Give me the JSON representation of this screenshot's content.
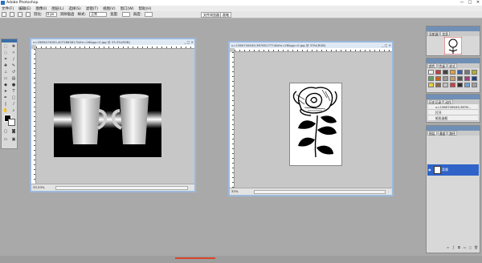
{
  "window": {
    "title": "Adobe Photoshop",
    "controls": [
      "—",
      "□",
      "✕"
    ]
  },
  "menu": [
    "文件(F)",
    "编辑(E)",
    "图像(I)",
    "图层(L)",
    "选择(S)",
    "滤镜(T)",
    "视图(V)",
    "窗口(W)",
    "帮助(H)"
  ],
  "options": {
    "feather_label": "羽化:",
    "feather_value": "0 px",
    "antialias_label": "消除锯齿",
    "style_label": "样式:",
    "style_value": "正常",
    "width_label": "宽度:",
    "height_label": "高度:",
    "right_tabs": [
      "文件浏览器",
      "画笔"
    ]
  },
  "documents": {
    "cups": {
      "title": "u=2985474050,4072865817&fm=26&gp=0.jpg @ 33.3%(RGB)",
      "status": "33.33%"
    },
    "rose": {
      "title": "u=1360749049,3676517774&fm=26&gp=0.jpg @ 33%(RGB)",
      "status": "33%"
    }
  },
  "panels": {
    "navigator": {
      "tabs": [
        "导航器",
        "信息"
      ]
    },
    "swatches": {
      "tabs": [
        "颜色",
        "色板",
        "样式"
      ]
    },
    "history": {
      "tabs": [
        "历史记录",
        "动作"
      ],
      "items": [
        "u=1360749049,3676...",
        "打开",
        "矩形选框"
      ]
    },
    "layers": {
      "tabs": [
        "图层",
        "通道",
        "路径"
      ],
      "layer_name": "背景"
    }
  },
  "colors": {
    "accent": "#3a6fd0",
    "title_accent": "#6f8fb6"
  }
}
